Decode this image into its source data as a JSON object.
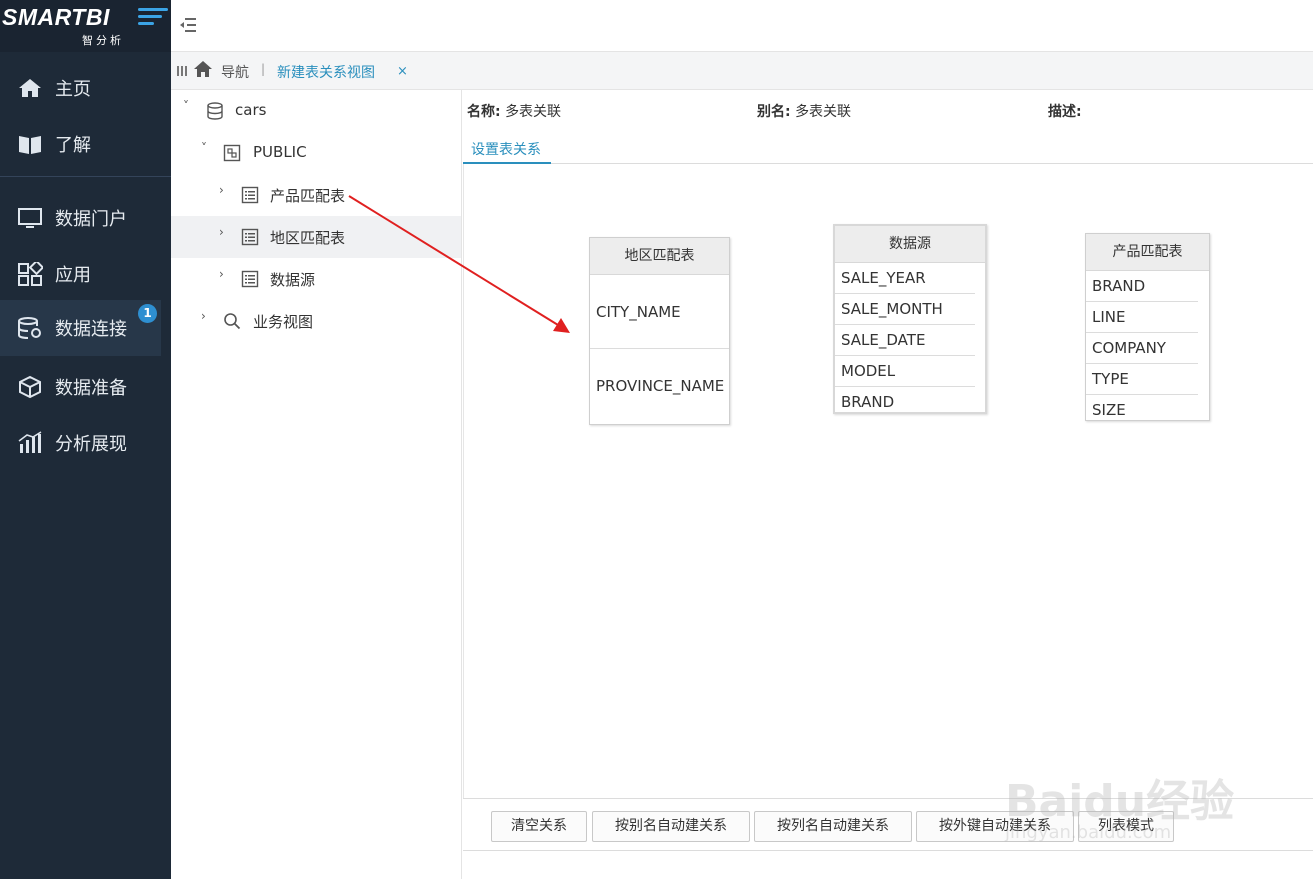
{
  "brand": {
    "name": "SMARTBI",
    "sub": "智分析"
  },
  "sidebar": {
    "items": [
      {
        "label": "主页",
        "icon": "home-icon"
      },
      {
        "label": "了解",
        "icon": "book-icon"
      },
      {
        "label": "数据门户",
        "icon": "monitor-icon"
      },
      {
        "label": "应用",
        "icon": "apps-icon"
      },
      {
        "label": "数据连接",
        "icon": "database-gear-icon",
        "active": true,
        "badge": "1"
      },
      {
        "label": "数据准备",
        "icon": "cube-icon"
      },
      {
        "label": "分析展现",
        "icon": "bar-chart-icon"
      }
    ]
  },
  "tabs": {
    "nav_label": "导航",
    "separator": "|",
    "active_tab": "新建表关系视图",
    "close": "×"
  },
  "tree": {
    "root": "cars",
    "schema": "PUBLIC",
    "tables": [
      "产品匹配表",
      "地区匹配表",
      "数据源"
    ],
    "business_view": "业务视图"
  },
  "meta": {
    "name_label": "名称:",
    "name_value": "多表关联",
    "alias_label": "别名:",
    "alias_value": "多表关联",
    "desc_label": "描述:"
  },
  "main_tab": "设置表关系",
  "diagram": {
    "tables": [
      {
        "title": "地区匹配表",
        "fields": [
          "CITY_NAME",
          "PROVINCE_NAME"
        ]
      },
      {
        "title": "数据源",
        "fields": [
          "SALE_YEAR",
          "SALE_MONTH",
          "SALE_DATE",
          "MODEL",
          "BRAND"
        ]
      },
      {
        "title": "产品匹配表",
        "fields": [
          "BRAND",
          "LINE",
          "COMPANY",
          "TYPE",
          "SIZE"
        ]
      }
    ]
  },
  "buttons": {
    "clear": "清空关系",
    "by_alias": "按别名自动建关系",
    "by_column": "按列名自动建关系",
    "by_fk": "按外键自动建关系",
    "list_mode": "列表模式"
  },
  "watermark": {
    "main": "Baidu经验",
    "sub": "jingyan.baidu.com"
  },
  "colors": {
    "sidebar_bg": "#1e2a38",
    "accent": "#2a8fbd",
    "arrow": "#e02020"
  }
}
